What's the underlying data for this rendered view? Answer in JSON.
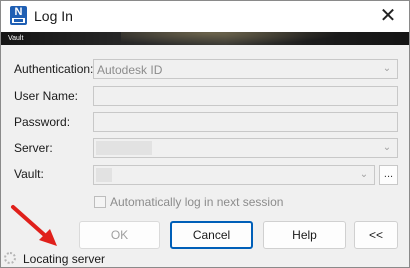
{
  "window": {
    "title": "Log In"
  },
  "app_icon": {
    "letter": "N"
  },
  "banner": {
    "text": "Vault"
  },
  "form": {
    "authentication": {
      "label": "Authentication:",
      "value": "Autodesk ID"
    },
    "username": {
      "label": "User Name:",
      "value": ""
    },
    "password": {
      "label": "Password:",
      "value": ""
    },
    "server": {
      "label": "Server:",
      "value": ""
    },
    "vault": {
      "label": "Vault:",
      "value": ""
    },
    "browse_label": "...",
    "auto_login": {
      "label": "Automatically log in next session",
      "checked": false
    }
  },
  "buttons": {
    "ok": "OK",
    "cancel": "Cancel",
    "help": "Help",
    "collapse": "<<"
  },
  "status": {
    "text": "Locating server"
  },
  "icons": {
    "close": "close-icon",
    "dropdown": "chevron-down-icon",
    "spinner": "spinner-icon",
    "annotation": "red-arrow-icon"
  },
  "colors": {
    "accent": "#005fb8",
    "app_icon": "#1f5fb4",
    "annotation_arrow": "#e0201b"
  }
}
